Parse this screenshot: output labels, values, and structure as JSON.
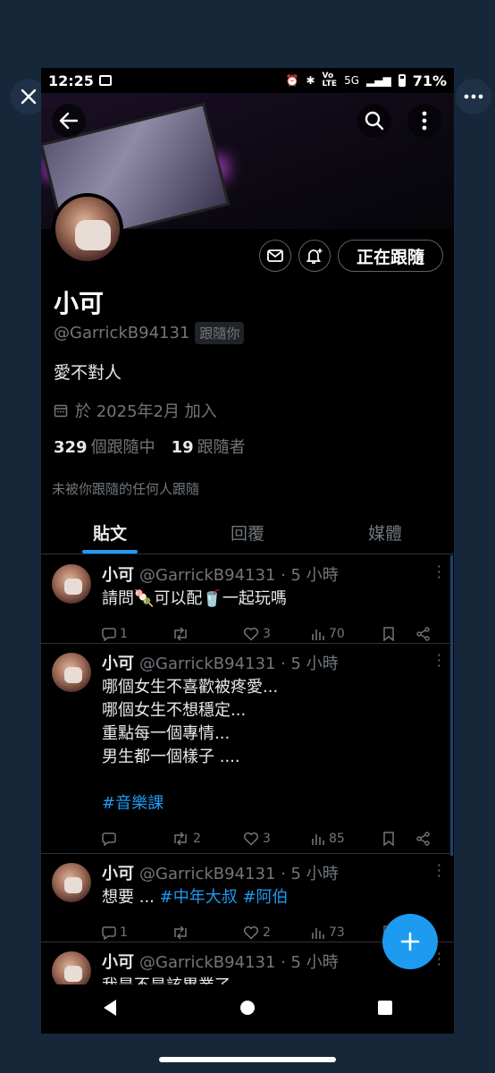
{
  "status_bar": {
    "time": "12:25",
    "network": "5G",
    "battery": "71%"
  },
  "profile": {
    "name": "小可",
    "handle": "@GarrickB94131",
    "follows_you": "跟隨你",
    "bio": "愛不對人",
    "joined": "於 2025年2月 加入",
    "following_count": "329",
    "following_label": "個跟隨中",
    "followers_count": "19",
    "followers_label": "跟隨者",
    "not_followed_note": "未被你跟隨的任何人跟隨",
    "follow_button": "正在跟隨"
  },
  "tabs": [
    {
      "label": "貼文",
      "active": true
    },
    {
      "label": "回覆",
      "active": false
    },
    {
      "label": "媒體",
      "active": false
    }
  ],
  "tweets": [
    {
      "name": "小可",
      "meta": "@GarrickB94131 · 5 小時",
      "text_before": "請問🍡可以配🥤一起玩嗎",
      "lines": [],
      "hashtags": [],
      "replies": "1",
      "retweets": "",
      "likes": "3",
      "views": "70"
    },
    {
      "name": "小可",
      "meta": "@GarrickB94131 · 5 小時",
      "lines": [
        "哪個女生不喜歡被疼愛...",
        "哪個女生不想穩定...",
        "重點每一個專情...",
        "男生都一個樣子 ...."
      ],
      "hashtag_line": "#音樂課",
      "replies": "",
      "retweets": "2",
      "likes": "3",
      "views": "85"
    },
    {
      "name": "小可",
      "meta": "@GarrickB94131 · 5 小時",
      "text_before": "想要 ... ",
      "hashtags": [
        "#中年大叔",
        "#阿伯"
      ],
      "replies": "1",
      "retweets": "",
      "likes": "2",
      "views": "73"
    },
    {
      "name": "小可",
      "meta": "@GarrickB94131 · 5 小時",
      "text_before": "我是不是該畢業了"
    }
  ],
  "colors": {
    "accent": "#1d9bf0",
    "background": "#000000",
    "outer_background": "#16273a",
    "muted_text": "#71767b"
  },
  "icons": [
    "close-icon",
    "more-icon",
    "back-arrow-icon",
    "search-icon",
    "more-vertical-icon",
    "mail-icon",
    "bell-plus-icon",
    "calendar-icon",
    "reply-icon",
    "retweet-icon",
    "heart-icon",
    "views-icon",
    "bookmark-icon",
    "share-icon",
    "plus-icon"
  ]
}
